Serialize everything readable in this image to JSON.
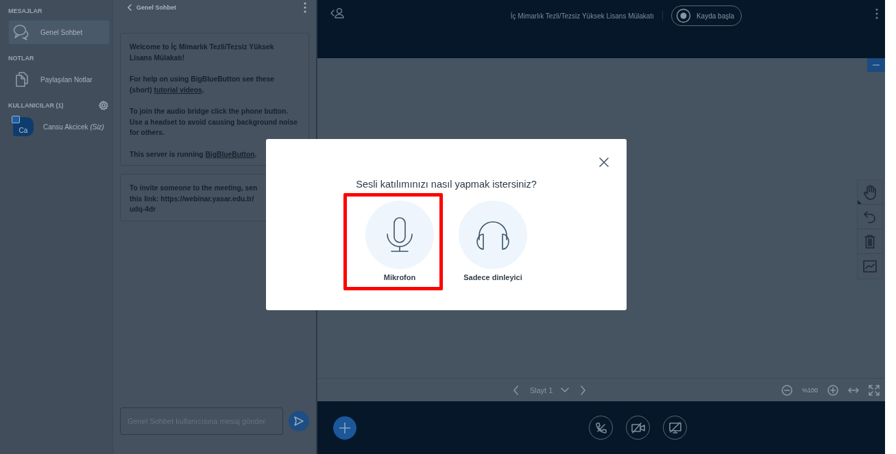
{
  "sidebar": {
    "sections": [
      {
        "title": "MESAJLAR",
        "items": [
          {
            "kind": "chat",
            "label": "Genel Sohbet",
            "selected": true
          }
        ]
      },
      {
        "title": "NOTLAR",
        "items": [
          {
            "kind": "notes",
            "label": "Paylaşılan Notlar",
            "selected": false
          }
        ]
      },
      {
        "title": "KULLANICILAR (1)",
        "settings": true,
        "items": [
          {
            "kind": "user",
            "avatar": "Ca",
            "label": "Cansu Akcicek *(Siz)*",
            "selected": false
          }
        ]
      }
    ]
  },
  "chat": {
    "title": "Genel Sohbet",
    "messages": [
      {
        "paragraphs": [
          [
            [
              {
                "text": "Welcome to İç Mimarlık Tezli/Tezsiz Yüksek"
              }
            ],
            [
              {
                "text": "Lisans Mülakatı!"
              }
            ]
          ],
          [
            [
              {
                "text": "For help on using BigBlueButton see these"
              }
            ],
            [
              {
                "text": "(short) "
              },
              {
                "text": "tutorial videos",
                "link": true
              },
              {
                "text": "."
              }
            ]
          ],
          [
            [
              {
                "text": "To join the audio bridge click the phone button."
              }
            ],
            [
              {
                "text": "Use a headset to avoid causing background noise"
              }
            ],
            [
              {
                "text": "for others."
              }
            ]
          ],
          [
            [
              {
                "text": "This server is running "
              },
              {
                "text": "BigBlueButton",
                "link": true
              },
              {
                "text": "."
              }
            ]
          ]
        ]
      },
      {
        "paragraphs": [
          [
            [
              {
                "text": "To invite someone to the meeting, sen"
              }
            ],
            [
              {
                "text": "this link: https://webinar.yasar.edu.tr/"
              }
            ],
            [
              {
                "text": "udq-4dr"
              }
            ]
          ]
        ]
      }
    ],
    "input": {
      "placeholder": "Genel Sohbet kullanıcısına mesaj gönder"
    }
  },
  "topbar": {
    "title": "İç Mimarlık Tezli/Tezsiz Yüksek Lisans Mülakatı",
    "record_label": "Kayda başla"
  },
  "slide_nav": {
    "label": "Slayt 1",
    "zoom": "%100"
  },
  "modal": {
    "question": "Sesli katılımınızı nasıl yapmak istersiniz?",
    "options": [
      {
        "kind": "microphone",
        "label": "Mikrofon",
        "highlighted": true
      },
      {
        "kind": "listen",
        "label": "Sadece dinleyici",
        "highlighted": false
      }
    ]
  }
}
